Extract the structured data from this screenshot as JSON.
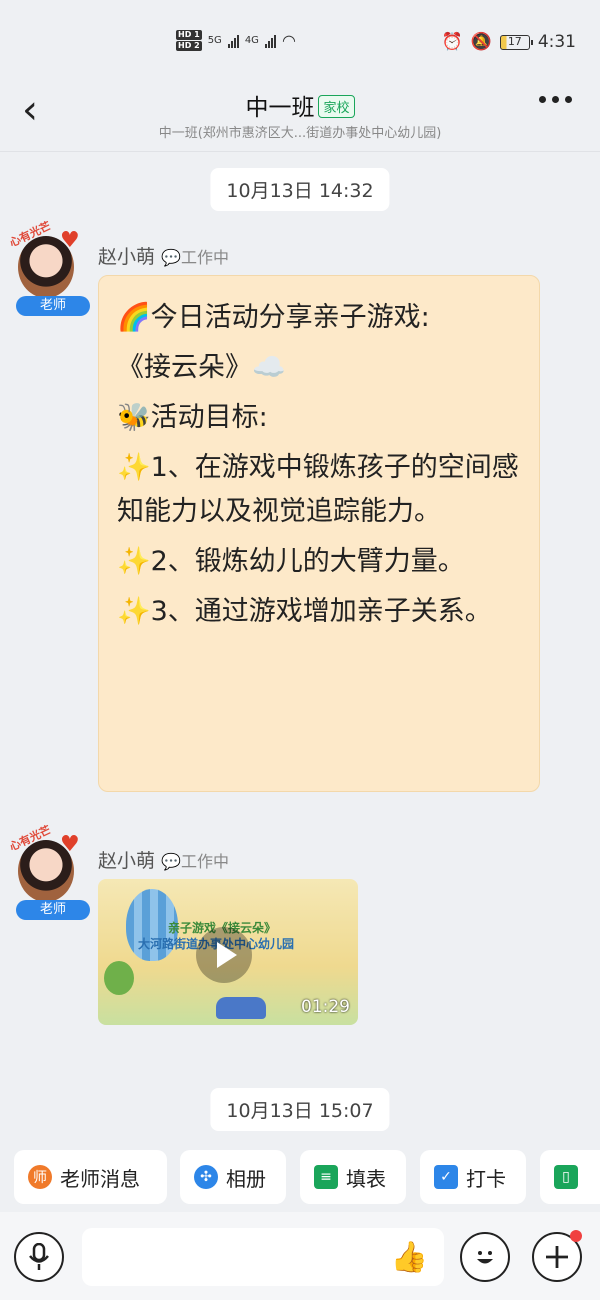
{
  "status_bar": {
    "hd1": "HD 1",
    "hd2": "HD 2",
    "net1": "5G",
    "net2": "4G",
    "battery": "17",
    "time": "4:31"
  },
  "header": {
    "back_icon": "chevron-left-icon",
    "title": "中一班",
    "tag": "家校",
    "subtitle": "中一班(郑州市惠济区大...街道办事处中心幼儿园)",
    "more_icon": "more-dots-icon"
  },
  "messages": [
    {
      "timestamp": "10月13日 14:32",
      "sender": "赵小萌",
      "sender_status": "💬工作中",
      "role": "老师",
      "avatar_caption": "心有光芒",
      "lines": [
        "🌈今日活动分享亲子游戏:",
        "《接云朵》☁️",
        "🐝活动目标:",
        "✨1、在游戏中锻炼孩子的空间感知能力以及视觉追踪能力。",
        "✨2、锻炼幼儿的大臂力量。",
        "✨3、通过游戏增加亲子关系。"
      ]
    },
    {
      "sender": "赵小萌",
      "sender_status": "💬工作中",
      "role": "老师",
      "avatar_caption": "心有光芒",
      "video": {
        "caption1": "亲子游戏《接云朵》",
        "caption2": "大河路街道办事处中心幼儿园",
        "duration": "01:29"
      }
    }
  ],
  "timestamp2": "10月13日 15:07",
  "quick_actions": [
    {
      "label": "老师消息",
      "icon": "teacher-icon",
      "color": "#f07a2a"
    },
    {
      "label": "相册",
      "icon": "album-icon",
      "color": "#2d86e8"
    },
    {
      "label": "填表",
      "icon": "form-icon",
      "color": "#1aa55a"
    },
    {
      "label": "打卡",
      "icon": "checkin-icon",
      "color": "#2d86e8"
    },
    {
      "label": "",
      "icon": "notebook-icon",
      "color": "#1aa55a"
    }
  ],
  "input_bar": {
    "voice_icon": "microphone-icon",
    "like_icon": "thumbs-up-icon",
    "emoji_icon": "smiley-icon",
    "plus_icon": "plus-icon"
  }
}
